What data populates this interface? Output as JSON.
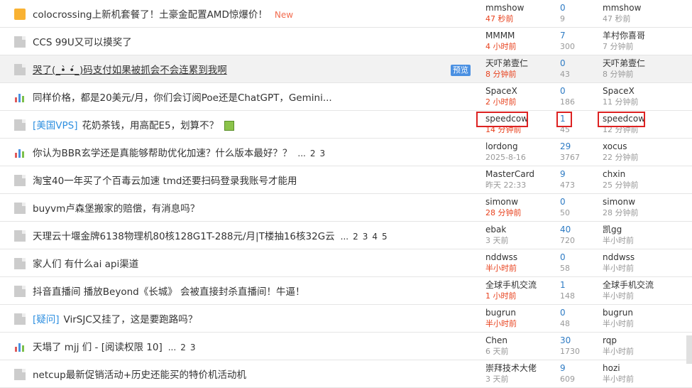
{
  "rows": [
    {
      "icon": "folder-icon",
      "tag": "",
      "title": "colocrossing上新机套餐了！土豪金配置AMD惊爆价！",
      "new": "New",
      "pages": [],
      "perm": "",
      "preview": "",
      "author": "mmshow",
      "author_time": "47 秒前",
      "author_time_red": true,
      "replies": "0",
      "views": "9",
      "last": "mmshow",
      "last_time": "47 秒前"
    },
    {
      "icon": "doc-icon",
      "tag": "",
      "title": "CCS 99U又可以摸奖了",
      "new": "",
      "pages": [],
      "perm": "",
      "preview": "",
      "author": "MMMM",
      "author_time": "4 小时前",
      "author_time_red": true,
      "replies": "7",
      "views": "300",
      "last": "羊村你喜哥",
      "last_time": "7 分钟前"
    },
    {
      "icon": "doc-icon",
      "tag": "",
      "title": "哭了(_•̀ •́_)码支付如果被抓会不会连累到我啊",
      "new": "",
      "pages": [],
      "perm": "",
      "preview": "预览",
      "author": "天吓弟壹仁",
      "author_time": "8 分钟前",
      "author_time_red": true,
      "replies": "0",
      "views": "43",
      "last": "天吓弟壹仁",
      "last_time": "8 分钟前"
    },
    {
      "icon": "poll-icon",
      "tag": "",
      "title": "同样价格，都是20美元/月，你们会订阅Poe还是ChatGPT，Gemini...",
      "new": "",
      "pages": [],
      "perm": "",
      "preview": "",
      "author": "SpaceX",
      "author_time": "2 小时前",
      "author_time_red": true,
      "replies": "0",
      "views": "186",
      "last": "SpaceX",
      "last_time": "11 分钟前"
    },
    {
      "icon": "doc-icon",
      "tag": "[美国VPS]",
      "title": "花奶茶钱，用高配E5，划算不？",
      "new": "",
      "pages": [],
      "perm": "",
      "preview": "",
      "image_icon": true,
      "author": "speedcow",
      "author_time": "14 分钟前",
      "author_time_red": true,
      "replies": "1",
      "views": "45",
      "last": "speedcow",
      "last_time": "12 分钟前"
    },
    {
      "icon": "poll-icon",
      "tag": "",
      "title": "你认为BBR玄学还是真能够帮助优化加速？什么版本最好？？",
      "new": "",
      "pages": [
        "...",
        "2",
        "3"
      ],
      "perm": "",
      "preview": "",
      "author": "lordong",
      "author_time": "2025-8-16",
      "author_time_red": false,
      "replies": "29",
      "views": "3767",
      "last": "xocus",
      "last_time": "22 分钟前"
    },
    {
      "icon": "doc-icon",
      "tag": "",
      "title": "淘宝40一年买了个百毒云加速 tmd还要扫码登录我账号才能用",
      "new": "",
      "pages": [],
      "perm": "",
      "preview": "",
      "author": "MasterCard",
      "author_time": "昨天 22:33",
      "author_time_red": false,
      "replies": "9",
      "views": "473",
      "last": "chxin",
      "last_time": "25 分钟前"
    },
    {
      "icon": "doc-icon",
      "tag": "",
      "title": "buyvm卢森堡搬家的赔偿，有消息吗？",
      "new": "",
      "pages": [],
      "perm": "",
      "preview": "",
      "author": "simonw",
      "author_time": "28 分钟前",
      "author_time_red": true,
      "replies": "0",
      "views": "50",
      "last": "simonw",
      "last_time": "28 分钟前"
    },
    {
      "icon": "doc-icon",
      "tag": "",
      "title": "天理云十堰金牌6138物理机80核128G1T-288元/月|T楼抽16核32G云",
      "new": "",
      "pages": [
        "...",
        "2",
        "3",
        "4",
        "5"
      ],
      "perm": "",
      "preview": "",
      "author": "ebak",
      "author_time": "3 天前",
      "author_time_red": false,
      "replies": "40",
      "views": "720",
      "last": "凯gg",
      "last_time": "半小时前"
    },
    {
      "icon": "doc-icon",
      "tag": "",
      "title": "家人们 有什么ai api渠道",
      "new": "",
      "pages": [],
      "perm": "",
      "preview": "",
      "author": "nddwss",
      "author_time": "半小时前",
      "author_time_red": true,
      "replies": "0",
      "views": "58",
      "last": "nddwss",
      "last_time": "半小时前"
    },
    {
      "icon": "doc-icon",
      "tag": "",
      "title": "抖音直播间 播放Beyond《长城》 会被直接封杀直播间！牛逼！",
      "new": "",
      "pages": [],
      "perm": "",
      "preview": "",
      "author": "全球手机交流",
      "author_time": "1 小时前",
      "author_time_red": true,
      "replies": "1",
      "views": "148",
      "last": "全球手机交流",
      "last_time": "半小时前"
    },
    {
      "icon": "doc-icon",
      "tag": "[疑问]",
      "title": "VirSJC又挂了，这是要跑路吗？",
      "new": "",
      "pages": [],
      "perm": "",
      "preview": "",
      "author": "bugrun",
      "author_time": "半小时前",
      "author_time_red": true,
      "replies": "0",
      "views": "48",
      "last": "bugrun",
      "last_time": "半小时前"
    },
    {
      "icon": "poll-icon",
      "tag": "",
      "title": "天塌了 mjj 们",
      "new": "",
      "pages": [
        "...",
        "2",
        "3"
      ],
      "perm": "[阅读权限 10]",
      "preview": "",
      "author": "Chen",
      "author_time": "6 天前",
      "author_time_red": false,
      "replies": "30",
      "views": "1730",
      "last": "rqp",
      "last_time": "半小时前"
    },
    {
      "icon": "doc-icon",
      "tag": "",
      "title": "netcup最新促销活动+历史还能买的特价机活动机",
      "new": "",
      "pages": [],
      "perm": "",
      "preview": "",
      "author": "崇拜技术大佬",
      "author_time": "3 天前",
      "author_time_red": false,
      "replies": "9",
      "views": "609",
      "last": "hozi",
      "last_time": "半小时前"
    }
  ],
  "colors": {
    "red": "#e8421e",
    "blue": "#2e7bc4",
    "tag": "#2e8fe0",
    "new": "#f26c4f",
    "highlight_box": "#dd2222"
  }
}
